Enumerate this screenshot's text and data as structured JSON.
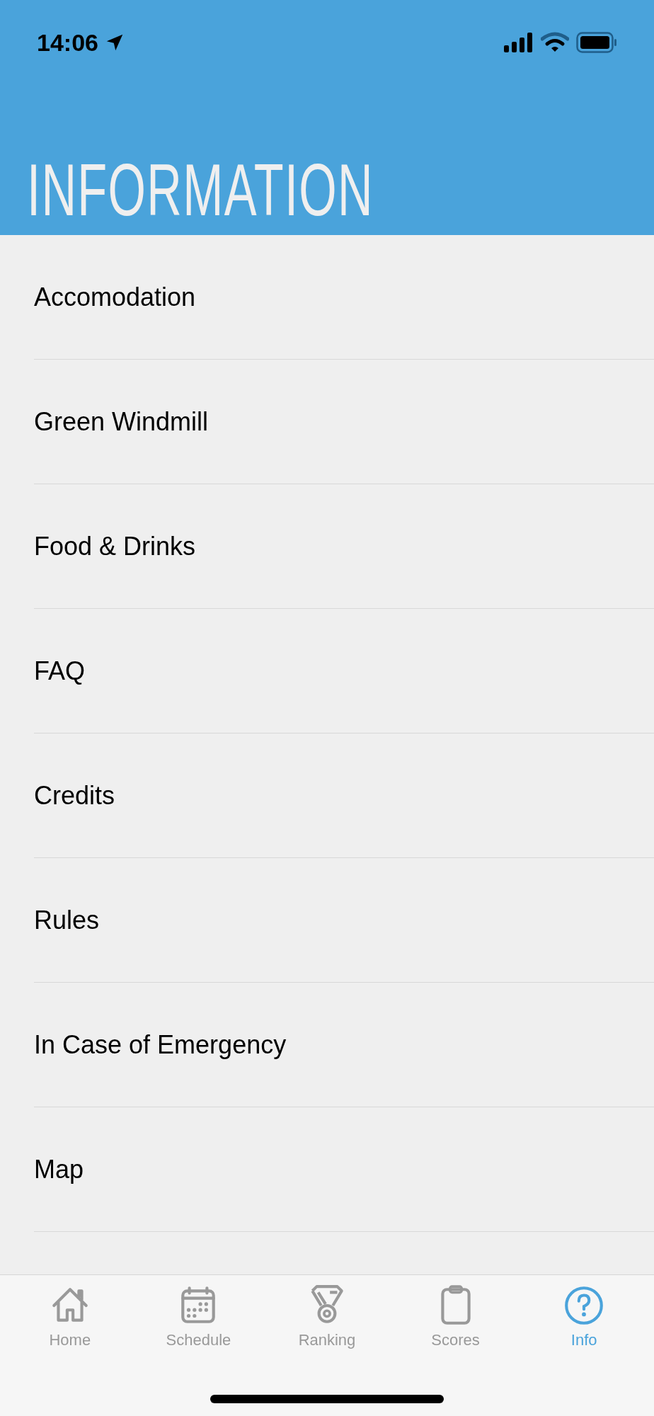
{
  "status_bar": {
    "time": "14:06"
  },
  "header": {
    "title": "INFORMATION"
  },
  "items": [
    {
      "label": "Accomodation"
    },
    {
      "label": "Green Windmill"
    },
    {
      "label": "Food & Drinks"
    },
    {
      "label": "FAQ"
    },
    {
      "label": "Credits"
    },
    {
      "label": "Rules"
    },
    {
      "label": "In Case of Emergency"
    },
    {
      "label": "Map"
    }
  ],
  "tabs": [
    {
      "label": "Home",
      "selected": false
    },
    {
      "label": "Schedule",
      "selected": false
    },
    {
      "label": "Ranking",
      "selected": false
    },
    {
      "label": "Scores",
      "selected": false
    },
    {
      "label": "Info",
      "selected": true
    }
  ]
}
